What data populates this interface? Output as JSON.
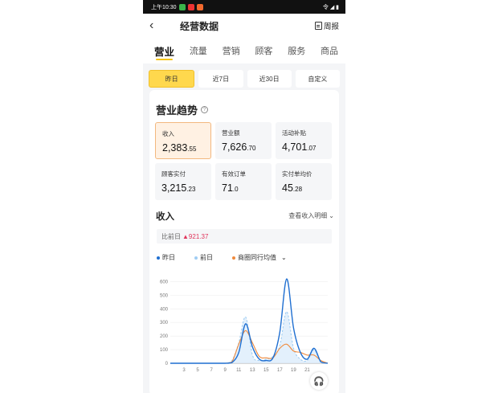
{
  "status_bar": {
    "time": "上午10:30",
    "right_text": "令 ◢ ▮"
  },
  "nav": {
    "title": "经营数据",
    "weekly_label": "周报"
  },
  "tabs": [
    {
      "label": "营业",
      "active": true
    },
    {
      "label": "流量"
    },
    {
      "label": "营销"
    },
    {
      "label": "顾客"
    },
    {
      "label": "服务"
    },
    {
      "label": "商品"
    }
  ],
  "ranges": [
    {
      "label": "昨日",
      "active": true
    },
    {
      "label": "近7日"
    },
    {
      "label": "近30日"
    },
    {
      "label": "自定义"
    }
  ],
  "section": {
    "title": "营业趋势",
    "help": "?"
  },
  "metrics": [
    {
      "label": "收入",
      "int": "2,383",
      "dec": ".55",
      "active": true
    },
    {
      "label": "营业额",
      "int": "7,626",
      "dec": ".70"
    },
    {
      "label": "活动补贴",
      "int": "4,701",
      "dec": ".07"
    },
    {
      "label": "顾客实付",
      "int": "3,215",
      "dec": ".23"
    },
    {
      "label": "有效订单",
      "int": "71",
      "dec": ".0"
    },
    {
      "label": "实付单均价",
      "int": "45",
      "dec": ".28"
    }
  ],
  "income": {
    "title": "收入",
    "detail_link": "查看收入明细",
    "compare_label": "比前日",
    "compare_value": "921.37"
  },
  "chart_data": {
    "type": "line",
    "x": [
      0,
      1,
      2,
      3,
      4,
      5,
      6,
      7,
      8,
      9,
      10,
      11,
      12,
      13,
      14,
      15,
      16,
      17,
      18,
      19,
      20,
      21,
      22,
      23
    ],
    "x_ticks": [
      "3",
      "5",
      "7",
      "9",
      "11",
      "13",
      "15",
      "17",
      "19",
      "21"
    ],
    "y_ticks": [
      "0",
      "100",
      "200",
      "300",
      "400",
      "500",
      "600"
    ],
    "ylim": [
      0,
      650
    ],
    "series": [
      {
        "name": "昨日",
        "color": "#1f6fd1",
        "style": "solid",
        "values": [
          0,
          0,
          0,
          0,
          0,
          0,
          0,
          0,
          0,
          5,
          80,
          290,
          120,
          30,
          20,
          40,
          230,
          620,
          260,
          80,
          30,
          110,
          10,
          0
        ]
      },
      {
        "name": "前日",
        "color": "#9fcdf3",
        "style": "dashed",
        "fill": true,
        "values": [
          0,
          0,
          0,
          0,
          0,
          0,
          0,
          0,
          0,
          20,
          150,
          340,
          60,
          20,
          30,
          50,
          130,
          380,
          110,
          30,
          20,
          100,
          5,
          0
        ]
      },
      {
        "name": "商圈同行均值",
        "color": "#f08a3c",
        "style": "solid",
        "values": [
          0,
          0,
          0,
          0,
          0,
          0,
          0,
          0,
          0,
          10,
          140,
          240,
          150,
          50,
          40,
          40,
          110,
          140,
          90,
          80,
          60,
          60,
          20,
          0
        ]
      }
    ]
  },
  "colors": {
    "accent": "#ffd84d",
    "delta": "#e0345b"
  }
}
